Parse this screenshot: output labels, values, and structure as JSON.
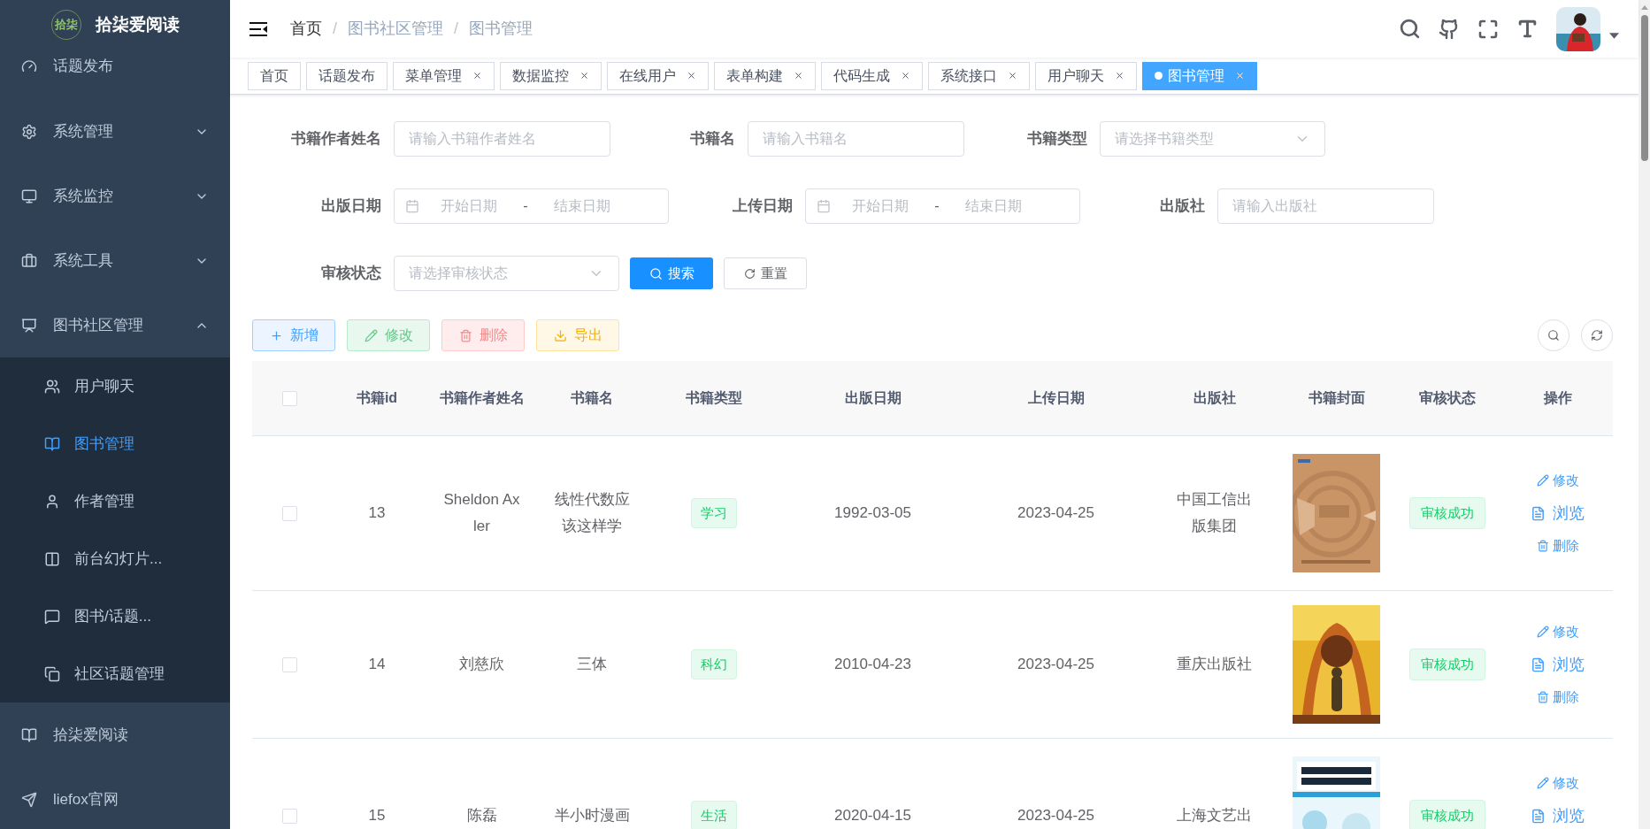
{
  "sidebar": {
    "logo_text": "拾柒",
    "title": "拾柒爱阅读",
    "items": [
      {
        "kind": "item",
        "label": "话题发布"
      },
      {
        "kind": "submenu",
        "label": "系统管理",
        "expanded": false
      },
      {
        "kind": "submenu",
        "label": "系统监控",
        "expanded": false
      },
      {
        "kind": "submenu",
        "label": "系统工具",
        "expanded": false
      },
      {
        "kind": "submenu",
        "label": "图书社区管理",
        "expanded": true,
        "children": [
          {
            "label": "用户聊天",
            "selected": false
          },
          {
            "label": "图书管理",
            "selected": true
          },
          {
            "label": "作者管理",
            "selected": false
          },
          {
            "label": "前台幻灯片...",
            "selected": false
          },
          {
            "label": "图书/话题...",
            "selected": false
          },
          {
            "label": "社区话题管理",
            "selected": false
          }
        ]
      },
      {
        "kind": "item",
        "label": "拾柒爱阅读"
      },
      {
        "kind": "item",
        "label": "liefox官网"
      }
    ]
  },
  "breadcrumb": {
    "separator": "/",
    "items": [
      {
        "label": "首页",
        "current": false
      },
      {
        "label": "图书社区管理",
        "current": true
      },
      {
        "label": "图书管理",
        "current": true
      }
    ]
  },
  "tabs": [
    {
      "label": "首页",
      "closable": false,
      "selected": false
    },
    {
      "label": "话题发布",
      "closable": false,
      "selected": false
    },
    {
      "label": "菜单管理",
      "closable": true,
      "selected": false
    },
    {
      "label": "数据监控",
      "closable": true,
      "selected": false
    },
    {
      "label": "在线用户",
      "closable": true,
      "selected": false
    },
    {
      "label": "表单构建",
      "closable": true,
      "selected": false
    },
    {
      "label": "代码生成",
      "closable": true,
      "selected": false
    },
    {
      "label": "系统接口",
      "closable": true,
      "selected": false
    },
    {
      "label": "用户聊天",
      "closable": true,
      "selected": false
    },
    {
      "label": "图书管理",
      "closable": true,
      "selected": true
    }
  ],
  "search_form": {
    "rows": [
      [
        {
          "kind": "text",
          "label": "书籍作者姓名",
          "placeholder": "请输入书籍作者姓名"
        },
        {
          "kind": "text",
          "label": "书籍名",
          "placeholder": "请输入书籍名"
        },
        {
          "kind": "select",
          "label": "书籍类型",
          "placeholder": "请选择书籍类型"
        }
      ],
      [
        {
          "kind": "daterange",
          "label": "出版日期",
          "start_placeholder": "开始日期",
          "separator": "-",
          "end_placeholder": "结束日期"
        },
        {
          "kind": "daterange",
          "label": "上传日期",
          "start_placeholder": "开始日期",
          "separator": "-",
          "end_placeholder": "结束日期"
        },
        {
          "kind": "text",
          "label": "出版社",
          "placeholder": "请输入出版社"
        }
      ],
      [
        {
          "kind": "select",
          "label": "审核状态",
          "placeholder": "请选择审核状态"
        }
      ]
    ],
    "buttons": [
      {
        "kind": "search",
        "label": "搜索"
      },
      {
        "kind": "reset",
        "label": "重置"
      }
    ]
  },
  "toolbar": [
    {
      "kind": "add",
      "label": "新增"
    },
    {
      "kind": "edit",
      "label": "修改"
    },
    {
      "kind": "delete",
      "label": "删除"
    },
    {
      "kind": "export",
      "label": "导出"
    }
  ],
  "table": {
    "select_all_checked": false,
    "columns": [
      "书籍id",
      "书籍作者姓名",
      "书籍名",
      "书籍类型",
      "出版日期",
      "上传日期",
      "出版社",
      "书籍封面",
      "审核状态",
      "操作"
    ],
    "rows": [
      {
        "checked": false,
        "id": "13",
        "author": "Sheldon Axler",
        "name": "线性代数应该这样学",
        "type": "学习",
        "publish_date": "1992-03-05",
        "upload_date": "2023-04-25",
        "publisher": "中国工信出版集团",
        "status": "审核成功",
        "actions": [
          "修改",
          "浏览",
          "删除"
        ]
      },
      {
        "checked": false,
        "id": "14",
        "author": "刘慈欣",
        "name": "三体",
        "type": "科幻",
        "publish_date": "2010-04-23",
        "upload_date": "2023-04-25",
        "publisher": "重庆出版社",
        "status": "审核成功",
        "actions": [
          "修改",
          "浏览",
          "删除"
        ]
      },
      {
        "checked": false,
        "id": "15",
        "author": "陈磊",
        "name": "半小时漫画",
        "type": "生活",
        "publish_date": "2020-04-15",
        "upload_date": "2023-04-25",
        "publisher": "上海文艺出",
        "status": "审核成功",
        "actions": [
          "修改",
          "浏览"
        ]
      }
    ]
  }
}
